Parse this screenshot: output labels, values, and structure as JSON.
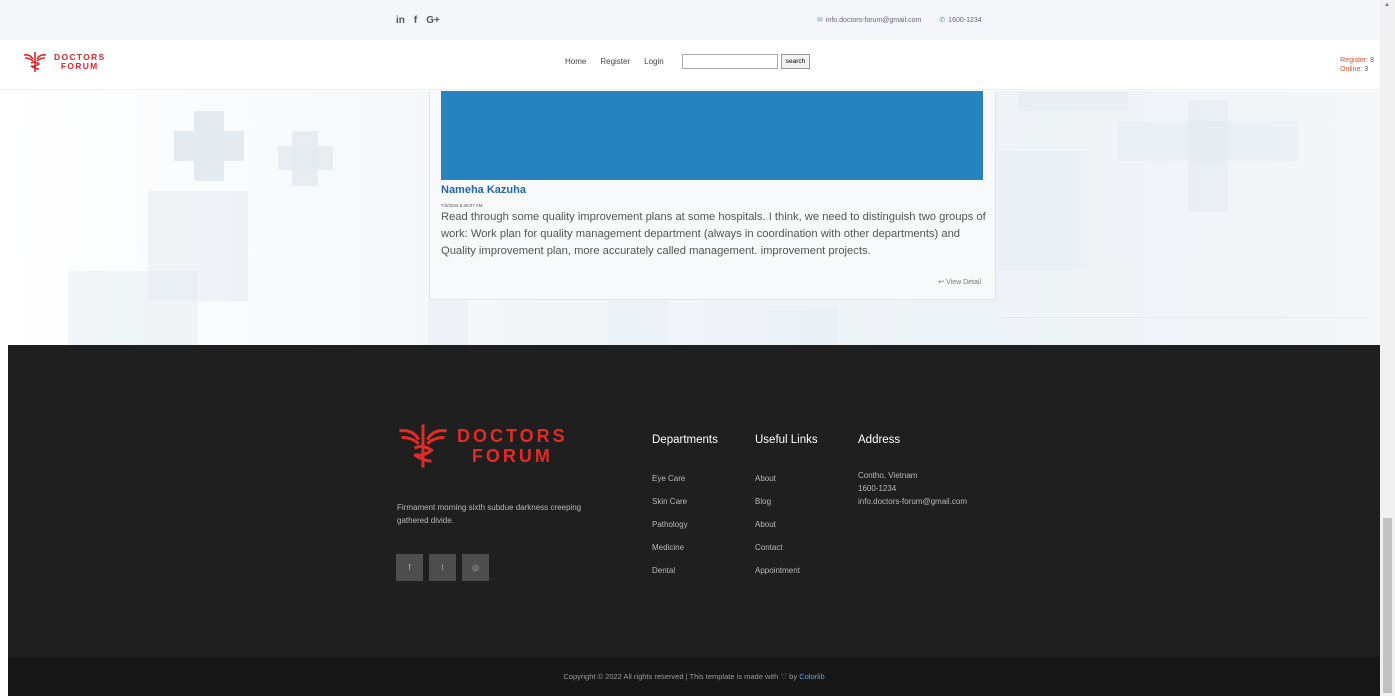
{
  "topbar": {
    "social": [
      "in",
      "f",
      "G+"
    ],
    "email": "info.doctors-forum@gmail.com",
    "phone": "1600-1234",
    "email_icon": "mail-icon",
    "phone_icon": "phone-icon"
  },
  "brand": {
    "line1": "DOCTORS",
    "line2": "FORUM",
    "color": "#d8282c"
  },
  "nav": {
    "items": [
      "Home",
      "Register",
      "Login"
    ],
    "search_value": "",
    "search_button": "search"
  },
  "stats": {
    "register_label": "Register:",
    "register_value": "8",
    "online_label": "Online:",
    "online_value": "3"
  },
  "post": {
    "author": "Nameha Kazuha",
    "date": "7/3/2022 5:28:07 AM",
    "content": "Read through some quality improvement plans at some hospitals. I think, we need to distinguish two groups of work: Work plan for quality management department (always in coordination with other departments) and Quality improvement plan, more accurately called management. improvement projects.",
    "detail_label": "View Detail",
    "image_color": "#2783c0"
  },
  "footer": {
    "description": "Firmament morning sixth subdue darkness creeping gathered divide.",
    "social": [
      "f",
      "t",
      "◎"
    ],
    "departments": {
      "title": "Departments",
      "items": [
        "Eye Care",
        "Skin Care",
        "Pathology",
        "Medicine",
        "Dental"
      ]
    },
    "useful_links": {
      "title": "Useful Links",
      "items": [
        "About",
        "Blog",
        "About",
        "Contact",
        "Appointment"
      ]
    },
    "address": {
      "title": "Address",
      "items": [
        "Contho, Vietnam",
        "1600-1234",
        "info.doctors-forum@gmail.com"
      ]
    },
    "copyright_text": "Copyright © 2022 All rights reserved | This template is made with ♡ by",
    "copyright_link": "Colorlib"
  }
}
